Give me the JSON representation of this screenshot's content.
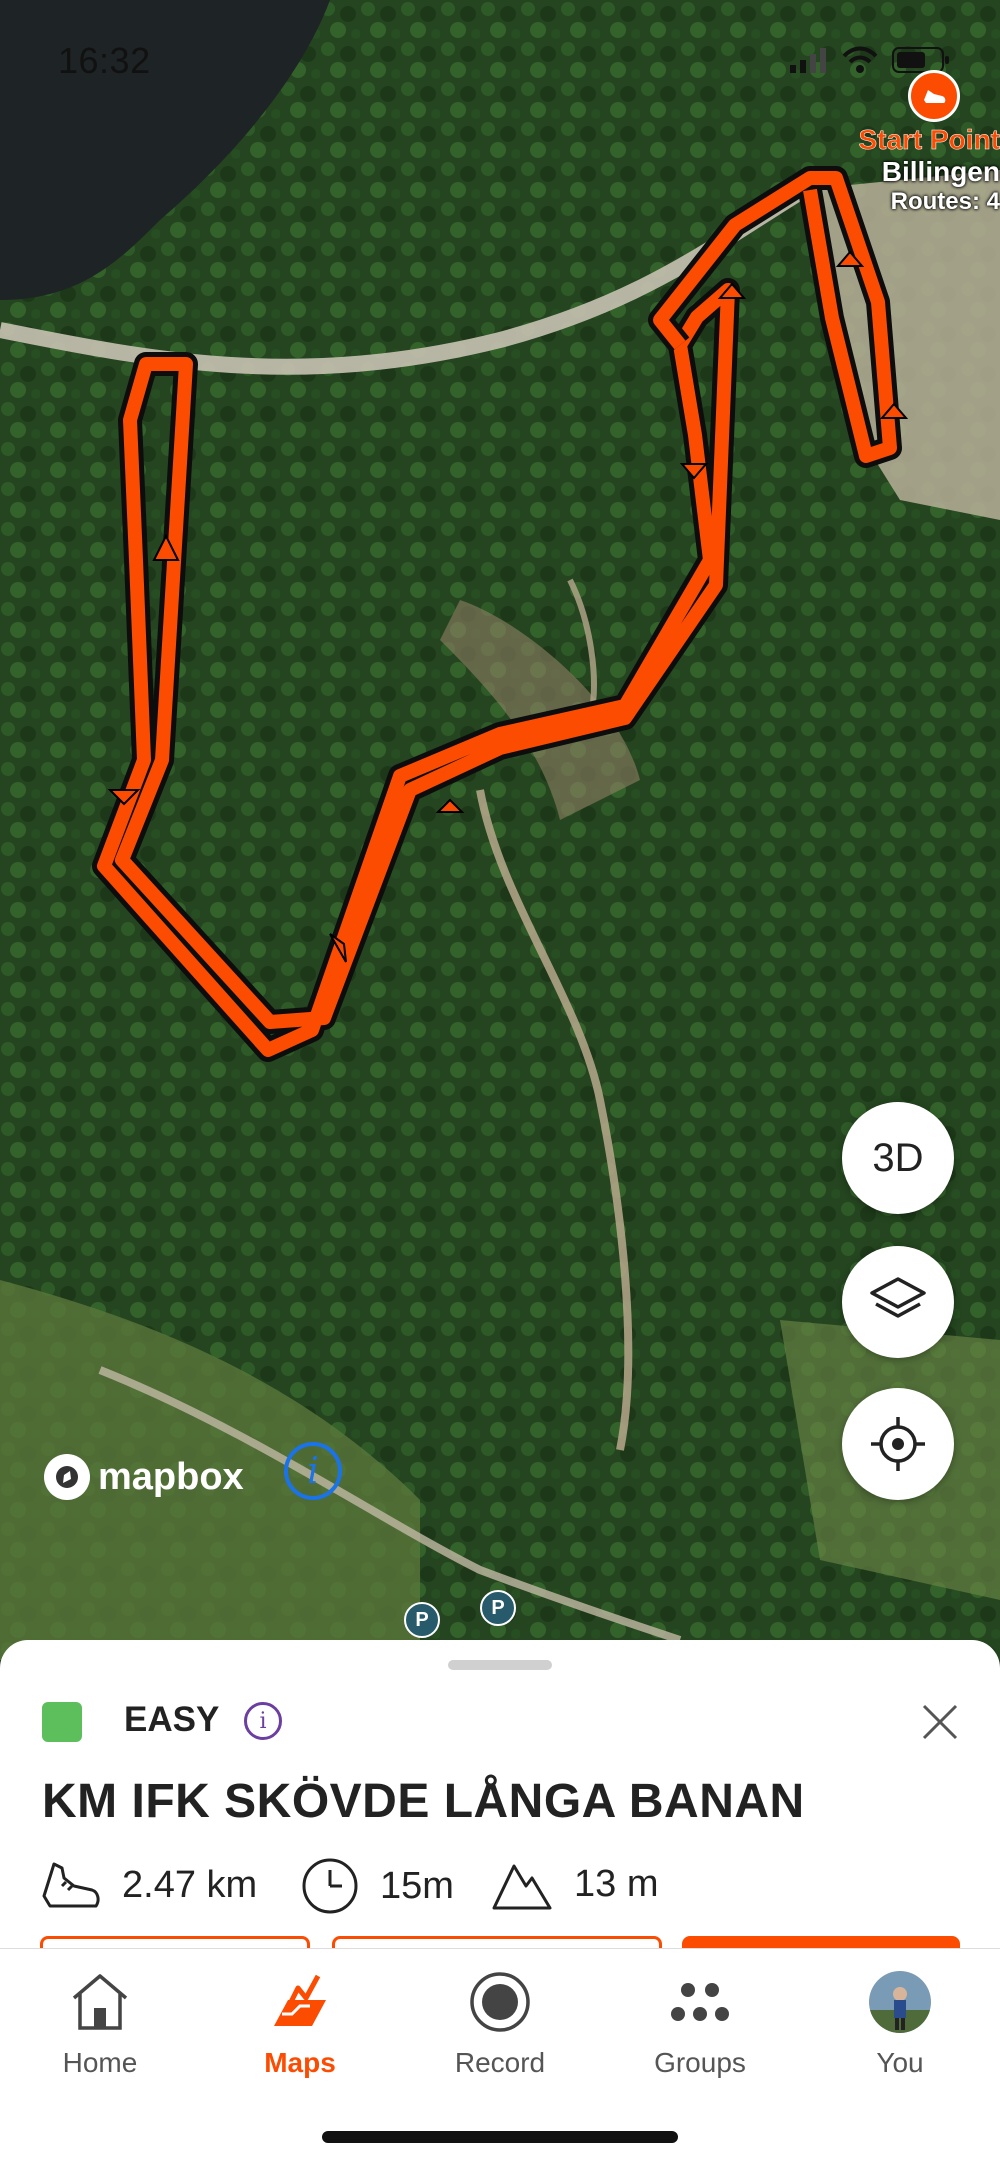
{
  "status_bar": {
    "time": "16:32"
  },
  "map": {
    "start_point": {
      "title": "Start Point",
      "name": "Billingen",
      "routes": "Routes: 4"
    },
    "buttons": {
      "three_d": "3D"
    },
    "attribution": "mapbox",
    "parking_label": "P",
    "route_color": "#fc4c02"
  },
  "route_sheet": {
    "difficulty": {
      "label": "EASY",
      "color": "#5cbf5c"
    },
    "name": "KM IFK SKÖVDE LÅNGA BANAN",
    "stats": {
      "distance": "2.47 km",
      "time": "15m",
      "elevation": "13 m"
    }
  },
  "tab_bar": {
    "items": [
      {
        "label": "Home",
        "icon": "home-icon"
      },
      {
        "label": "Maps",
        "icon": "maps-icon",
        "active": true
      },
      {
        "label": "Record",
        "icon": "record-icon"
      },
      {
        "label": "Groups",
        "icon": "groups-icon"
      },
      {
        "label": "You",
        "icon": "avatar"
      }
    ]
  }
}
